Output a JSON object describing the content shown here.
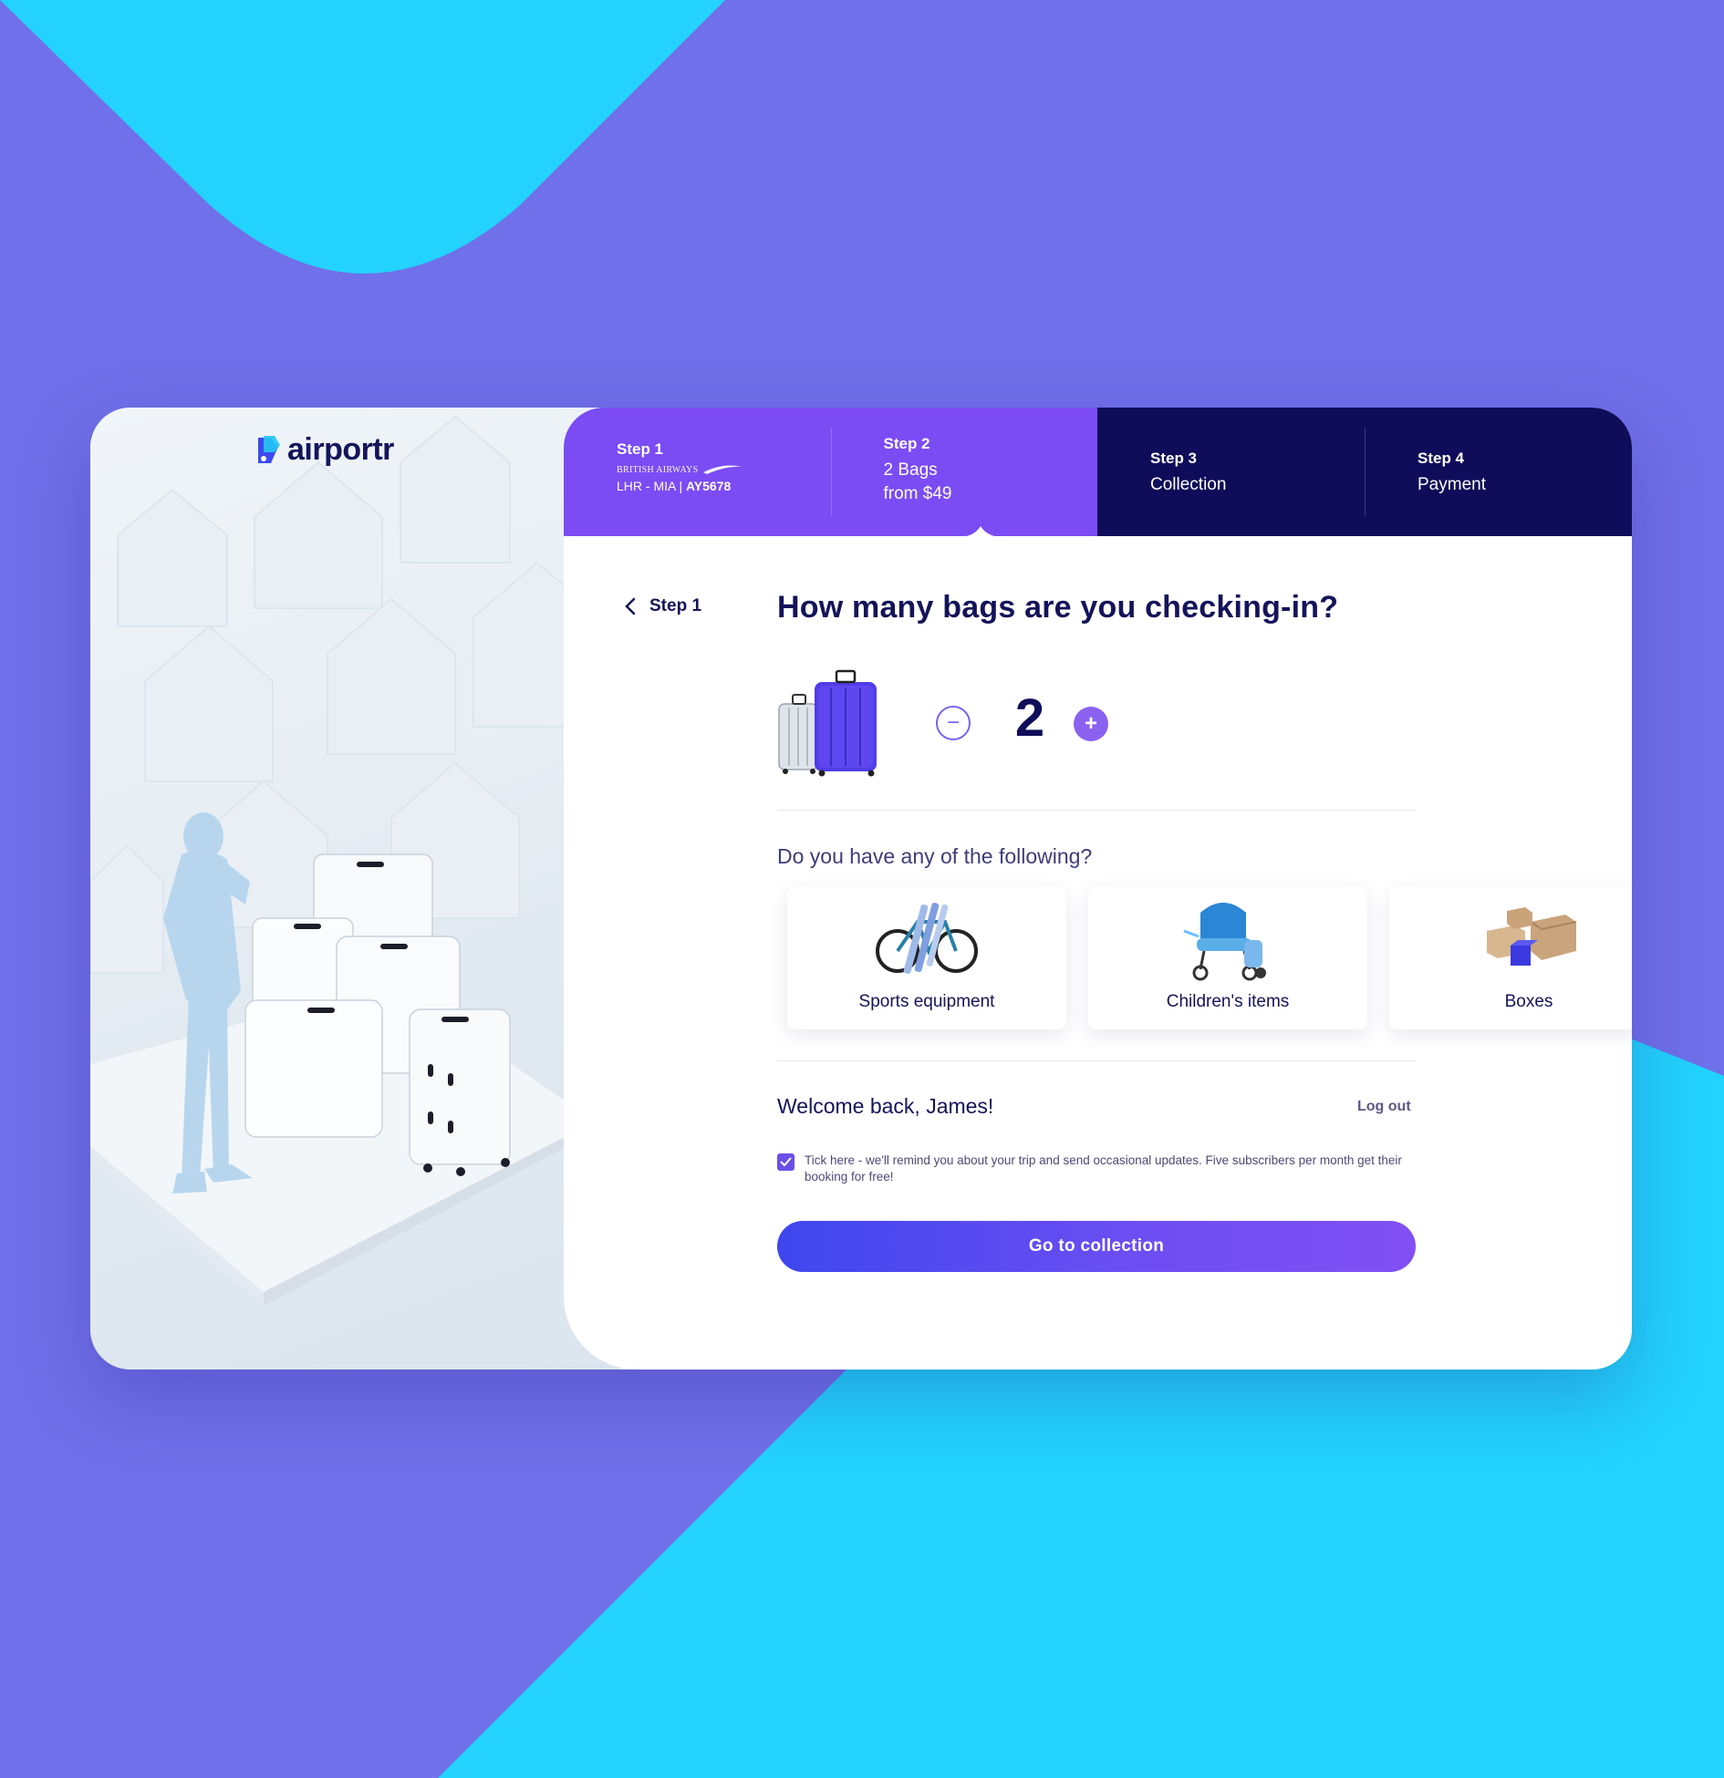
{
  "brand": {
    "name": "airportr"
  },
  "steps": [
    {
      "title": "Step 1",
      "airline": "BRITISH AIRWAYS",
      "route": "LHR - MIA | ",
      "flight": "AY5678"
    },
    {
      "title": "Step 2",
      "line1": "2 Bags",
      "line2": "from $49"
    },
    {
      "title": "Step 3",
      "line1": "Collection"
    },
    {
      "title": "Step 4",
      "line1": "Payment"
    }
  ],
  "form": {
    "back_label": "Step 1",
    "question": "How many bags are you checking-in?",
    "bag_count": "2",
    "minus_symbol": "−",
    "plus_symbol": "+",
    "extras_question": "Do you have any of the following?",
    "options": [
      {
        "label": "Sports equipment",
        "icon": "bicycle-icon"
      },
      {
        "label": "Children's items",
        "icon": "stroller-icon"
      },
      {
        "label": "Boxes",
        "icon": "boxes-icon"
      }
    ],
    "welcome": "Welcome back, James!",
    "logout": "Log out",
    "consent_checked": true,
    "consent_text": "Tick here - we'll remind you about your trip and send occasional updates. Five subscribers per month get their booking for free!",
    "cta_label": "Go to collection"
  },
  "colors": {
    "background_purple": "#7070ea",
    "background_cyan": "#23d2fd",
    "step_purple": "#7b4cf4",
    "step_navy": "#0f0c5a",
    "accent": "#6a4fe6"
  }
}
